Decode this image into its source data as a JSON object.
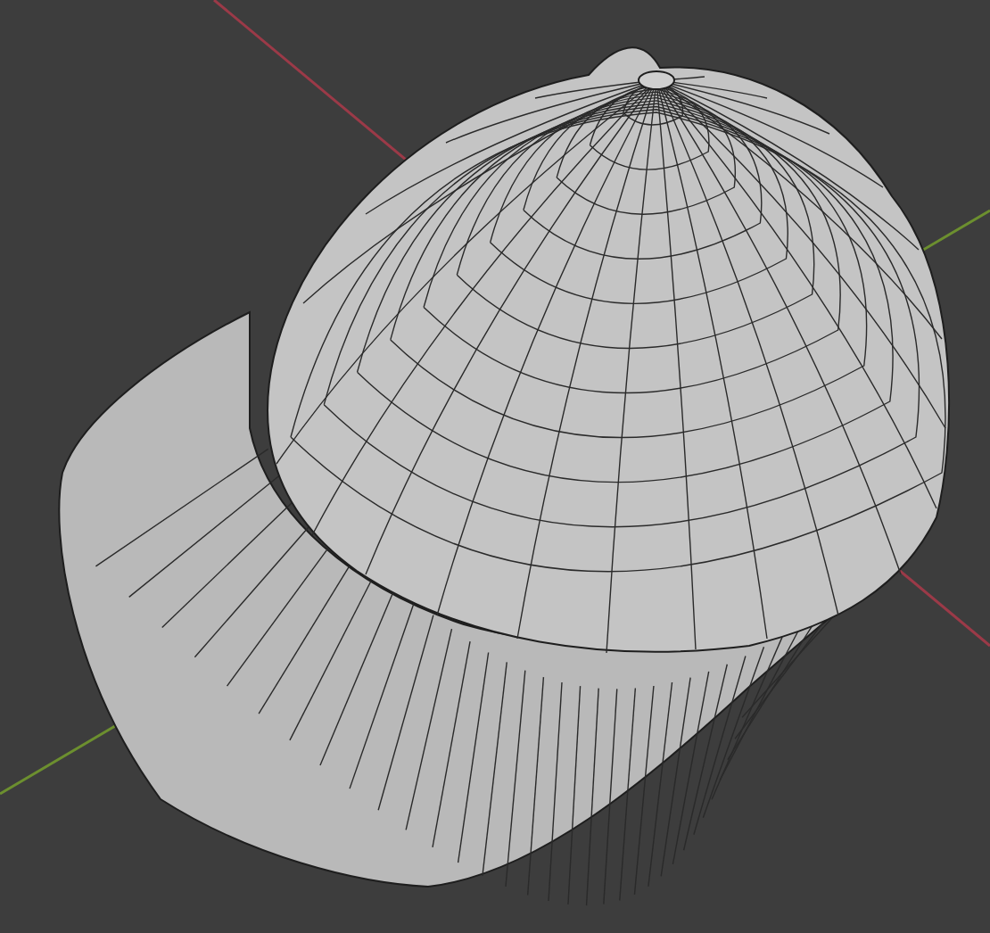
{
  "viewport": {
    "axis_lines": [
      {
        "color": "#9b3a48"
      },
      {
        "color": "#6c8f2f"
      }
    ]
  }
}
